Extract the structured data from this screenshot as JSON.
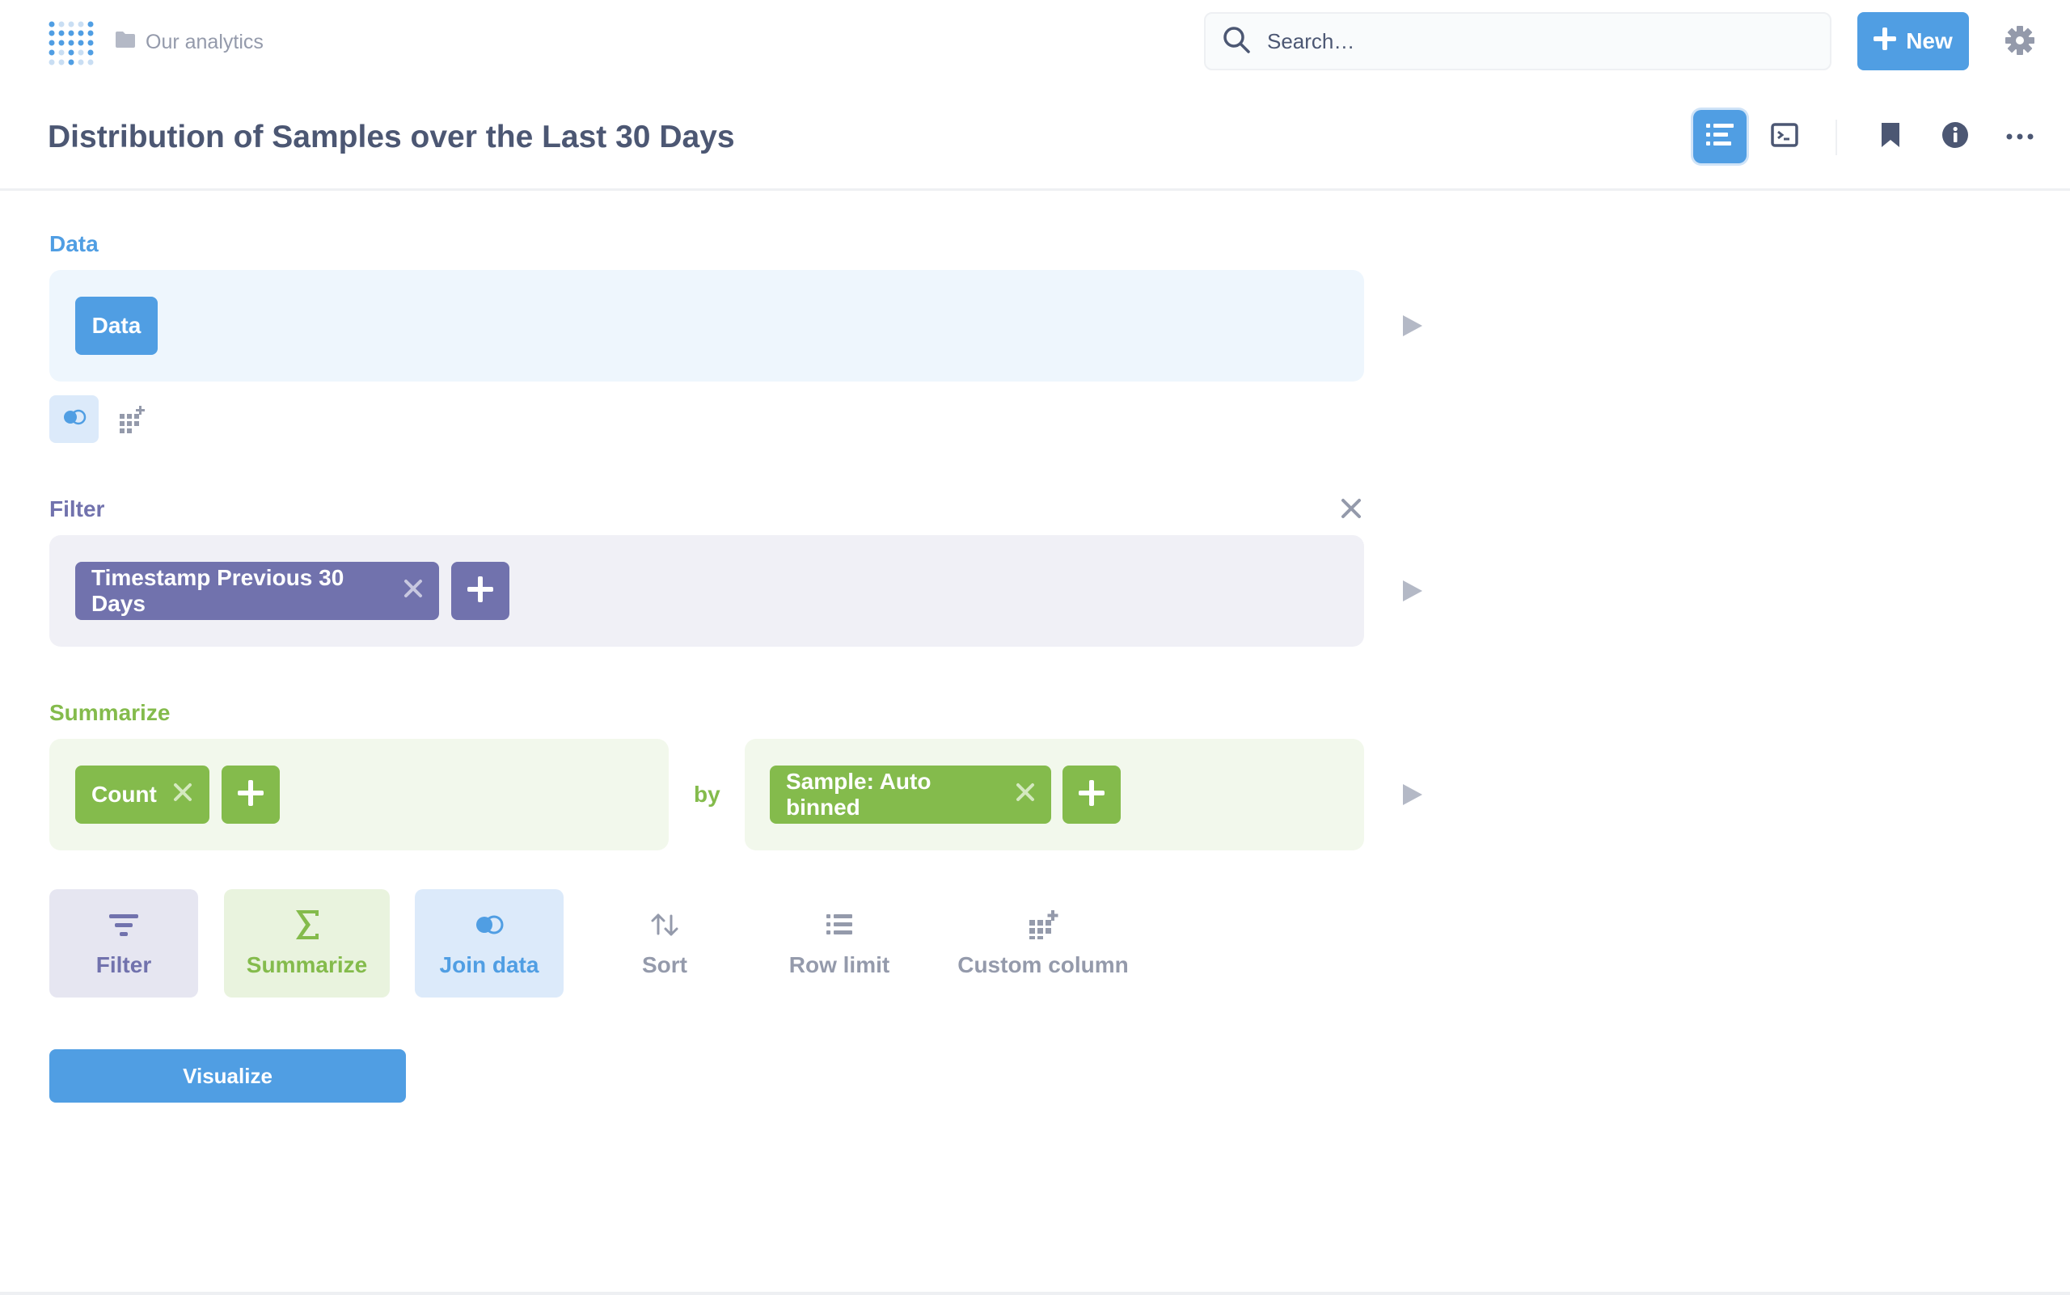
{
  "topbar": {
    "breadcrumb": "Our analytics",
    "search_placeholder": "Search…",
    "new_label": "New"
  },
  "header": {
    "title": "Distribution of Samples over the Last 30 Days"
  },
  "notebook": {
    "data": {
      "label": "Data",
      "source": "Data"
    },
    "filter": {
      "label": "Filter",
      "filters": [
        "Timestamp Previous 30 Days"
      ]
    },
    "summarize": {
      "label": "Summarize",
      "metrics": [
        "Count"
      ],
      "by_label": "by",
      "breakouts": [
        "Sample: Auto binned"
      ]
    }
  },
  "actions": {
    "filter": "Filter",
    "summarize": "Summarize",
    "join": "Join data",
    "sort": "Sort",
    "row_limit": "Row limit",
    "custom_column": "Custom column"
  },
  "visualize_label": "Visualize",
  "colors": {
    "brand": "#509ee3",
    "filter": "#7172ad",
    "summarize": "#84bb4c",
    "text_dark": "#4c5773",
    "text_light": "#949aab"
  },
  "icons": {
    "logo": "metabase-logo-icon",
    "folder": "folder-icon",
    "search": "search-icon",
    "plus": "plus-icon",
    "gear": "gear-icon",
    "notebook": "notebook-icon",
    "sql": "sql-icon",
    "bookmark": "bookmark-icon",
    "info": "info-icon",
    "more": "more-icon",
    "play": "play-icon",
    "join": "join-icon",
    "custom_column": "custom-column-icon",
    "close": "close-icon",
    "sort": "sort-icon",
    "list": "list-icon",
    "sigma": "sigma-icon"
  }
}
